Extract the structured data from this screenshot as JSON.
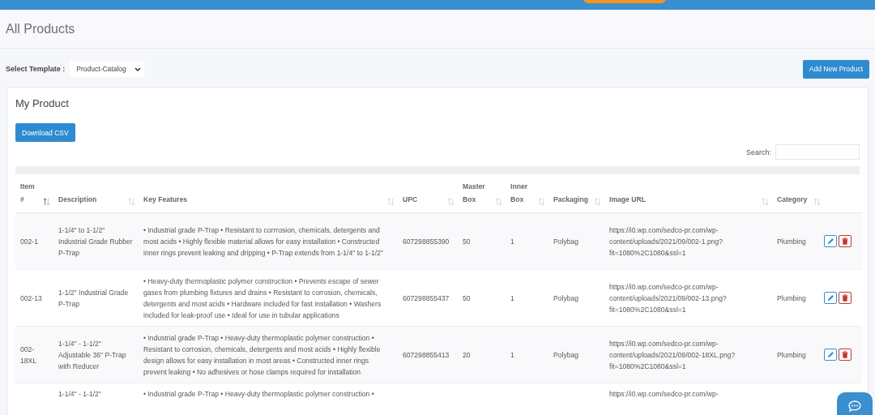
{
  "page": {
    "title": "All Products"
  },
  "toolbar": {
    "template_label": "Select Template :",
    "template_value": "Product-Catalog",
    "add_button": "Add New Product"
  },
  "card": {
    "title": "My Product",
    "download_button": "Download CSV",
    "search_label": "Search:"
  },
  "table": {
    "columns": [
      {
        "lines": [
          "Item",
          "#"
        ],
        "sorted": true
      },
      {
        "lines": [
          "Description"
        ],
        "sorted": false
      },
      {
        "lines": [
          "Key Features"
        ],
        "sorted": false
      },
      {
        "lines": [
          "UPC"
        ],
        "sorted": false
      },
      {
        "lines": [
          "Master",
          "Box"
        ],
        "sorted": false
      },
      {
        "lines": [
          "Inner",
          "Box"
        ],
        "sorted": false
      },
      {
        "lines": [
          "Packaging"
        ],
        "sorted": false
      },
      {
        "lines": [
          "Image URL"
        ],
        "sorted": false
      },
      {
        "lines": [
          "Category"
        ],
        "sorted": false
      }
    ],
    "rows": [
      {
        "item": "002-1",
        "description": "1-1/4\" to 1-1/2\" Industrial Grade Rubber P-Trap",
        "key_features": "• Industrial grade P-Trap • Resistant to corrrosion, chemicals, detergents and most acids • Highly flexible material allows for easy installation • Constructed inner rings prevent leaking and dripping • P-Trap extends from 1-1/4\" to 1-1/2\"",
        "upc": "607298855390",
        "master_box": "50",
        "inner_box": "1",
        "packaging": "Polybag",
        "image_url": "https://i0.wp.com/sedco-pr.com/wp-content/uploads/2021/09/002-1.png?fit=1080%2C1080&ssl=1",
        "category": "Plumbing"
      },
      {
        "item": "002-13",
        "description": "1-1/2\" Industrial Grade P-Trap",
        "key_features": "• Heavy-duty thermoplastic polymer construction • Prevents escape of sewer gases from plumbing fixtures and drains • Resistant to corrosion, chemicals, detergents and most acids • Hardware included for fast installation • Washers included for leak-proof use • Ideal for use in tubular applications",
        "upc": "607298855437",
        "master_box": "50",
        "inner_box": "1",
        "packaging": "Polybag",
        "image_url": "https://i0.wp.com/sedco-pr.com/wp-content/uploads/2021/09/002-13.png?fit=1080%2C1080&ssl=1",
        "category": "Plumbing"
      },
      {
        "item": "002-18XL",
        "description": "1-1/4\" - 1-1/2\" Adjustable 36\" P-Trap with Reducer",
        "key_features": "• Industrial grade P-Trap • Heavy-duty thermoplastic polymer construction • Resistant to corrosion, chemicals, detergents and most acids • Highly flexible design allows for easy installation in most areas • Constructed inner rings prevent leaking • No adhesives or hose clamps required for installation",
        "upc": "607298855413",
        "master_box": "20",
        "inner_box": "1",
        "packaging": "Polybag",
        "image_url": "https://i0.wp.com/sedco-pr.com/wp-content/uploads/2021/09/002-18XL.png?fit=1080%2C1080&ssl=1",
        "category": "Plumbing"
      }
    ],
    "partial_row": {
      "description": "1-1/4\" - 1-1/2\"",
      "key_features": "• Industrial grade P-Trap • Heavy-duty thermoplastic polymer construction •",
      "image_url": "https://i0.wp.com/sedco-pr.com/wp-"
    }
  }
}
